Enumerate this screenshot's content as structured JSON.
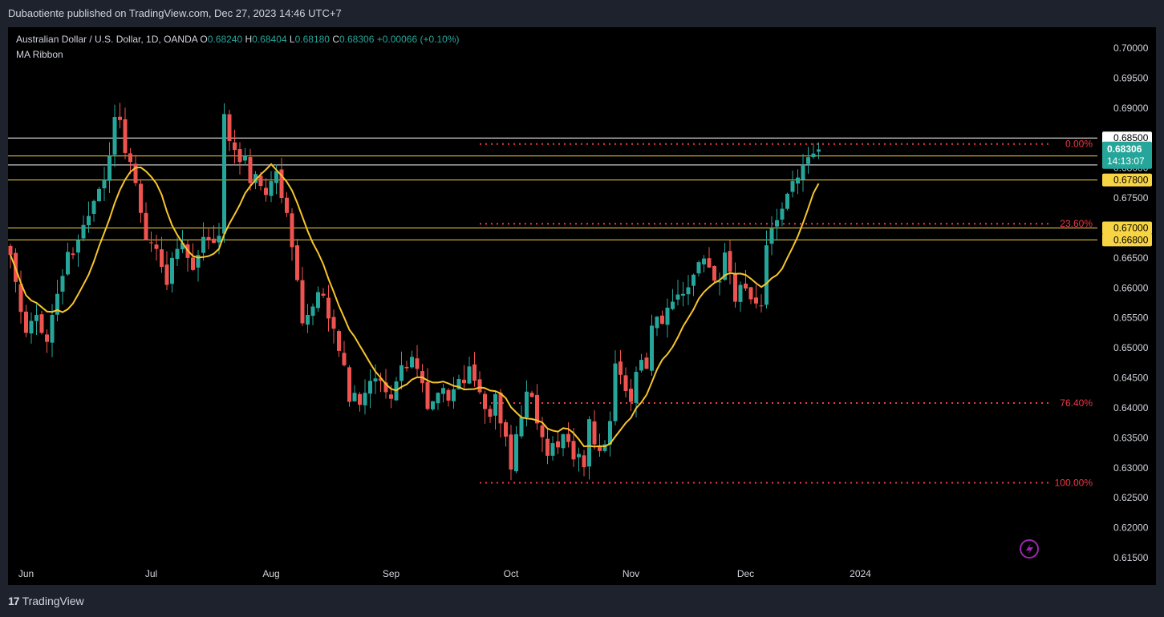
{
  "header": {
    "published_by": "Dubaotiente published on TradingView.com, Dec 27, 2023 14:46 UTC+7"
  },
  "legend": {
    "symbol": "Australian Dollar / U.S. Dollar, 1D, OANDA",
    "o_label": "O",
    "o_value": "0.68240",
    "h_label": "H",
    "h_value": "0.68404",
    "l_label": "L",
    "l_value": "0.68180",
    "c_label": "C",
    "c_value": "0.68306",
    "change": "+0.00066 (+0.10%)",
    "indicator": "MA Ribbon"
  },
  "footer": {
    "brand": "TradingView"
  },
  "colors": {
    "up": "#26a69a",
    "down": "#ef5350",
    "ma": "#f7c52a",
    "fib": "#f23645",
    "level_yellow": "#f7d443",
    "level_white": "#ffffff"
  },
  "chart_data": {
    "type": "candlestick",
    "symbol": "AUD/USD",
    "timeframe": "1D",
    "ylim": [
      0.615,
      0.7
    ],
    "y_ticks": [
      "0.70000",
      "0.69500",
      "0.69000",
      "0.68500",
      "0.68000",
      "0.67500",
      "0.67000",
      "0.66500",
      "0.66000",
      "0.65500",
      "0.65000",
      "0.64500",
      "0.64000",
      "0.63500",
      "0.63000",
      "0.62500",
      "0.62000",
      "0.61500"
    ],
    "x_ticks": [
      {
        "label": "Jun",
        "index": 3
      },
      {
        "label": "Jul",
        "index": 27
      },
      {
        "label": "Aug",
        "index": 50
      },
      {
        "label": "Sep",
        "index": 73
      },
      {
        "label": "Oct",
        "index": 96
      },
      {
        "label": "Nov",
        "index": 119
      },
      {
        "label": "Dec",
        "index": 141
      },
      {
        "label": "2024",
        "index": 163
      }
    ],
    "horizontal_levels": [
      {
        "value": 0.685,
        "label": "0.68500",
        "color": "#ffffff"
      },
      {
        "value": 0.6805,
        "label": "0.68306",
        "color": "#ffffff"
      },
      {
        "value": 0.682,
        "label": "0.68200",
        "color": "#f7d443"
      },
      {
        "value": 0.678,
        "label": "0.67800",
        "color": "#f7d443"
      },
      {
        "value": 0.67,
        "label": "0.67000",
        "color": "#f7d443"
      },
      {
        "value": 0.668,
        "label": "0.66800",
        "color": "#f7d443"
      }
    ],
    "price_tag": {
      "value": 0.68306,
      "label": "0.68306",
      "countdown": "14:13:07"
    },
    "fibonacci": [
      {
        "level": 0.0,
        "label": "0.00%",
        "price": 0.684
      },
      {
        "level": 0.236,
        "label": "23.60%",
        "price": 0.6707
      },
      {
        "level": 0.764,
        "label": "76.40%",
        "price": 0.6408
      },
      {
        "level": 1.0,
        "label": "100.00%",
        "price": 0.6275
      }
    ],
    "fib_start_index": 90,
    "closes": [
      0.6655,
      0.661,
      0.656,
      0.6525,
      0.6545,
      0.6555,
      0.6525,
      0.651,
      0.6555,
      0.659,
      0.662,
      0.666,
      0.6655,
      0.668,
      0.6705,
      0.672,
      0.6745,
      0.6765,
      0.678,
      0.682,
      0.6885,
      0.688,
      0.6825,
      0.681,
      0.6775,
      0.6725,
      0.668,
      0.6675,
      0.6665,
      0.6635,
      0.6605,
      0.665,
      0.6665,
      0.6675,
      0.665,
      0.663,
      0.6655,
      0.6685,
      0.668,
      0.6675,
      0.6687,
      0.689,
      0.6845,
      0.683,
      0.681,
      0.682,
      0.6775,
      0.679,
      0.677,
      0.6755,
      0.6778,
      0.6795,
      0.675,
      0.6725,
      0.6668,
      0.6613,
      0.6541,
      0.6555,
      0.6569,
      0.6593,
      0.6587,
      0.6549,
      0.6532,
      0.6495,
      0.6471,
      0.641,
      0.6425,
      0.6405,
      0.6425,
      0.6445,
      0.6449,
      0.6445,
      0.6426,
      0.6415,
      0.6444,
      0.6471,
      0.6466,
      0.6485,
      0.6465,
      0.6441,
      0.6398,
      0.6411,
      0.6425,
      0.6433,
      0.6412,
      0.6431,
      0.6448,
      0.6441,
      0.6469,
      0.6445,
      0.6426,
      0.6398,
      0.6385,
      0.6423,
      0.6374,
      0.6352,
      0.6297,
      0.6356,
      0.6384,
      0.6427,
      0.6418,
      0.6374,
      0.6351,
      0.632,
      0.6341,
      0.6334,
      0.6356,
      0.6343,
      0.6314,
      0.6323,
      0.6301,
      0.6381,
      0.6339,
      0.6328,
      0.6339,
      0.6378,
      0.6474,
      0.6455,
      0.6428,
      0.641,
      0.646,
      0.648,
      0.6465,
      0.6537,
      0.6552,
      0.654,
      0.6567,
      0.6577,
      0.6589,
      0.659,
      0.6601,
      0.6622,
      0.6643,
      0.6649,
      0.6634,
      0.6612,
      0.6611,
      0.6659,
      0.6627,
      0.6577,
      0.6605,
      0.6599,
      0.6581,
      0.6574,
      0.657,
      0.6671,
      0.6699,
      0.6713,
      0.6732,
      0.6757,
      0.6778,
      0.6784,
      0.6805,
      0.6818,
      0.6824,
      0.6831
    ],
    "ma_period": 10
  }
}
